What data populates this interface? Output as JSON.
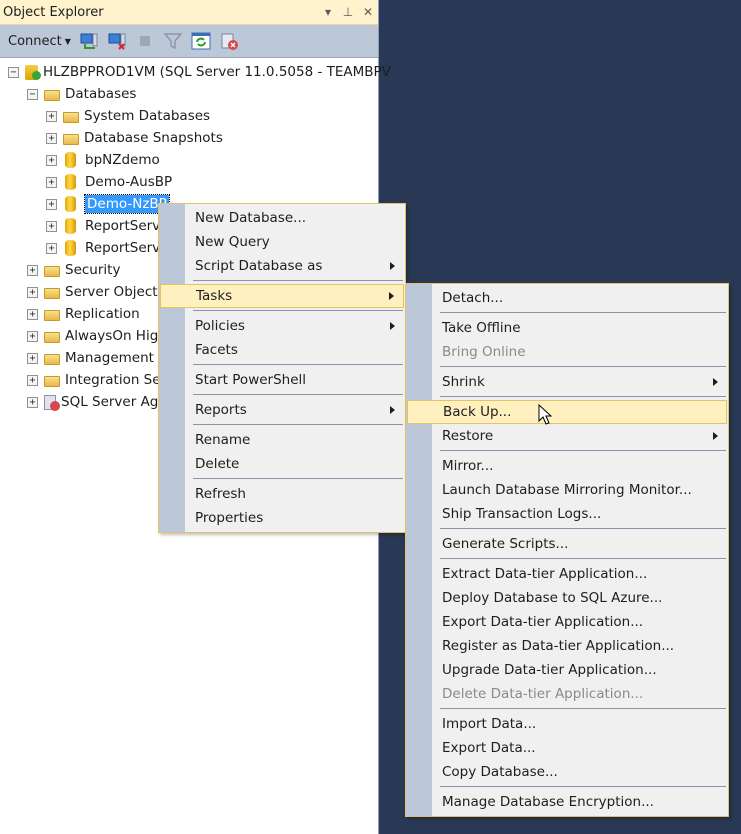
{
  "panel": {
    "title": "Object Explorer",
    "title_buttons": [
      "dropdown",
      "pin",
      "close"
    ],
    "toolbar": {
      "connect_label": "Connect",
      "buttons": [
        "connect-object-explorer",
        "disconnect",
        "stop",
        "filter",
        "refresh",
        "start-powershell"
      ]
    }
  },
  "tree": {
    "server": {
      "label": "HLZBPPROD1VM (SQL Server 11.0.5058 - TEAMBPV",
      "expanded": true
    },
    "databases": {
      "label": "Databases",
      "expanded": true
    },
    "db_children": [
      {
        "label": "System Databases",
        "type": "folder"
      },
      {
        "label": "Database Snapshots",
        "type": "folder"
      },
      {
        "label": "bpNZdemo",
        "type": "database"
      },
      {
        "label": "Demo-AusBP",
        "type": "database"
      },
      {
        "label": "Demo-NzBP",
        "type": "database",
        "selected": true
      },
      {
        "label": "ReportServe",
        "type": "database"
      },
      {
        "label": "ReportServe",
        "type": "database"
      }
    ],
    "server_children": [
      {
        "label": "Security",
        "type": "folder"
      },
      {
        "label": "Server Objects",
        "type": "folder"
      },
      {
        "label": "Replication",
        "type": "folder"
      },
      {
        "label": "AlwaysOn Hig",
        "type": "folder"
      },
      {
        "label": "Management",
        "type": "folder"
      },
      {
        "label": "Integration Se",
        "type": "folder"
      },
      {
        "label": "SQL Server Ag",
        "type": "agent"
      }
    ]
  },
  "context_menu": {
    "items": [
      {
        "label": "New Database..."
      },
      {
        "label": "New Query"
      },
      {
        "label": "Script Database as",
        "submenu": true
      },
      {
        "sep": true
      },
      {
        "label": "Tasks",
        "submenu": true,
        "highlighted": true
      },
      {
        "sep": true
      },
      {
        "label": "Policies",
        "submenu": true
      },
      {
        "label": "Facets"
      },
      {
        "sep": true
      },
      {
        "label": "Start PowerShell"
      },
      {
        "sep": true
      },
      {
        "label": "Reports",
        "submenu": true
      },
      {
        "sep": true
      },
      {
        "label": "Rename"
      },
      {
        "label": "Delete"
      },
      {
        "sep": true
      },
      {
        "label": "Refresh"
      },
      {
        "label": "Properties"
      }
    ]
  },
  "tasks_submenu": {
    "items": [
      {
        "label": "Detach..."
      },
      {
        "sep": true
      },
      {
        "label": "Take Offline"
      },
      {
        "label": "Bring Online",
        "disabled": true
      },
      {
        "sep": true
      },
      {
        "label": "Shrink",
        "submenu": true
      },
      {
        "sep": true
      },
      {
        "label": "Back Up...",
        "highlighted": true
      },
      {
        "label": "Restore",
        "submenu": true
      },
      {
        "sep": true
      },
      {
        "label": "Mirror..."
      },
      {
        "label": "Launch Database Mirroring Monitor..."
      },
      {
        "label": "Ship Transaction Logs..."
      },
      {
        "sep": true
      },
      {
        "label": "Generate Scripts..."
      },
      {
        "sep": true
      },
      {
        "label": "Extract Data-tier Application..."
      },
      {
        "label": "Deploy Database to SQL Azure..."
      },
      {
        "label": "Export Data-tier Application..."
      },
      {
        "label": "Register as Data-tier Application..."
      },
      {
        "label": "Upgrade Data-tier Application..."
      },
      {
        "label": "Delete Data-tier Application...",
        "disabled": true
      },
      {
        "sep": true
      },
      {
        "label": "Import Data..."
      },
      {
        "label": "Export Data..."
      },
      {
        "label": "Copy Database..."
      },
      {
        "sep": true
      },
      {
        "label": "Manage Database Encryption..."
      }
    ]
  },
  "colors": {
    "background": "#293955",
    "titlebar": "#fff3cd",
    "toolbar": "#bcc7d8",
    "menu_bg": "#f0f0f0",
    "menu_border": "#e5c365",
    "highlight": "#fff0c0",
    "selection": "#3399ff"
  }
}
